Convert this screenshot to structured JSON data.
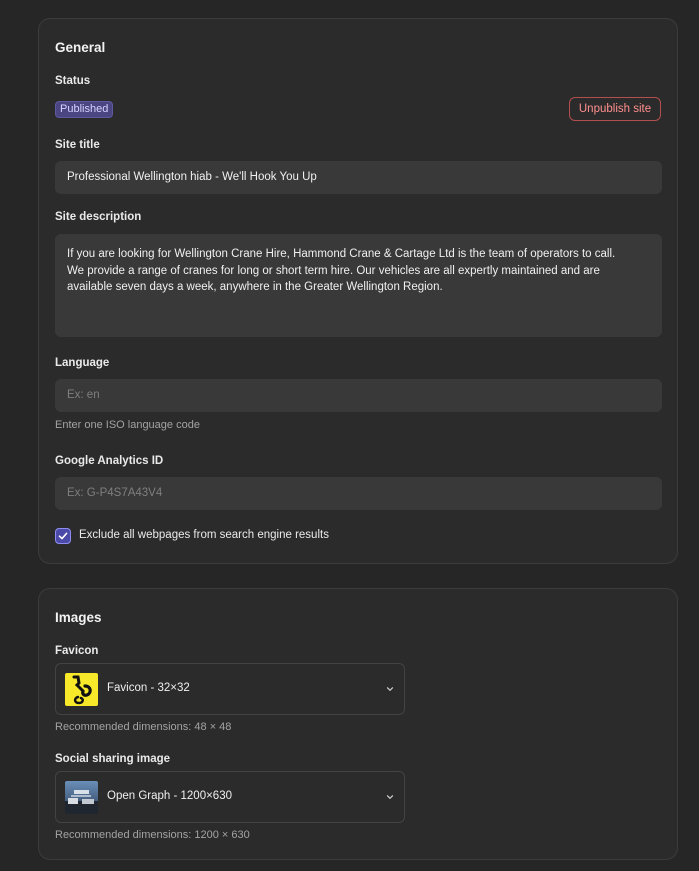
{
  "general": {
    "title": "General",
    "status_label": "Status",
    "status_badge": "Published",
    "unpublish_label": "Unpublish site",
    "site_title_label": "Site title",
    "site_title_value": "Professional Wellington hiab - We'll Hook You Up",
    "site_description_label": "Site description",
    "site_description_lines": [
      "If you are looking for Wellington Crane Hire, Hammond Crane & Cartage Ltd is the team of operators to call.",
      "We provide a range of cranes for long or short term hire. Our vehicles are all expertly maintained and are",
      "available seven days a week, anywhere in the Greater Wellington Region."
    ],
    "language_label": "Language",
    "language_placeholder": "Ex: en",
    "language_hint": "Enter one ISO language code",
    "analytics_label": "Google Analytics ID",
    "analytics_placeholder": "Ex: G-P4S7A43V4",
    "exclude_label": "Exclude all webpages from search engine results",
    "exclude_checked": true
  },
  "images": {
    "title": "Images",
    "favicon_label": "Favicon",
    "favicon_selected": "Favicon - 32×32",
    "favicon_hint": "Recommended dimensions: 48 × 48",
    "social_label": "Social sharing image",
    "social_selected": "Open Graph - 1200×630",
    "social_hint": "Recommended dimensions: 1200 × 630"
  },
  "colors": {
    "background": "#262626",
    "card": "#2b2b2b",
    "field": "#393939",
    "badge": "#4b4682",
    "danger": "#ff8f8f",
    "checkbox": "#4b4aa8"
  },
  "icons": {
    "checkbox": "check-icon",
    "dropdown": "chevron-down-icon"
  }
}
